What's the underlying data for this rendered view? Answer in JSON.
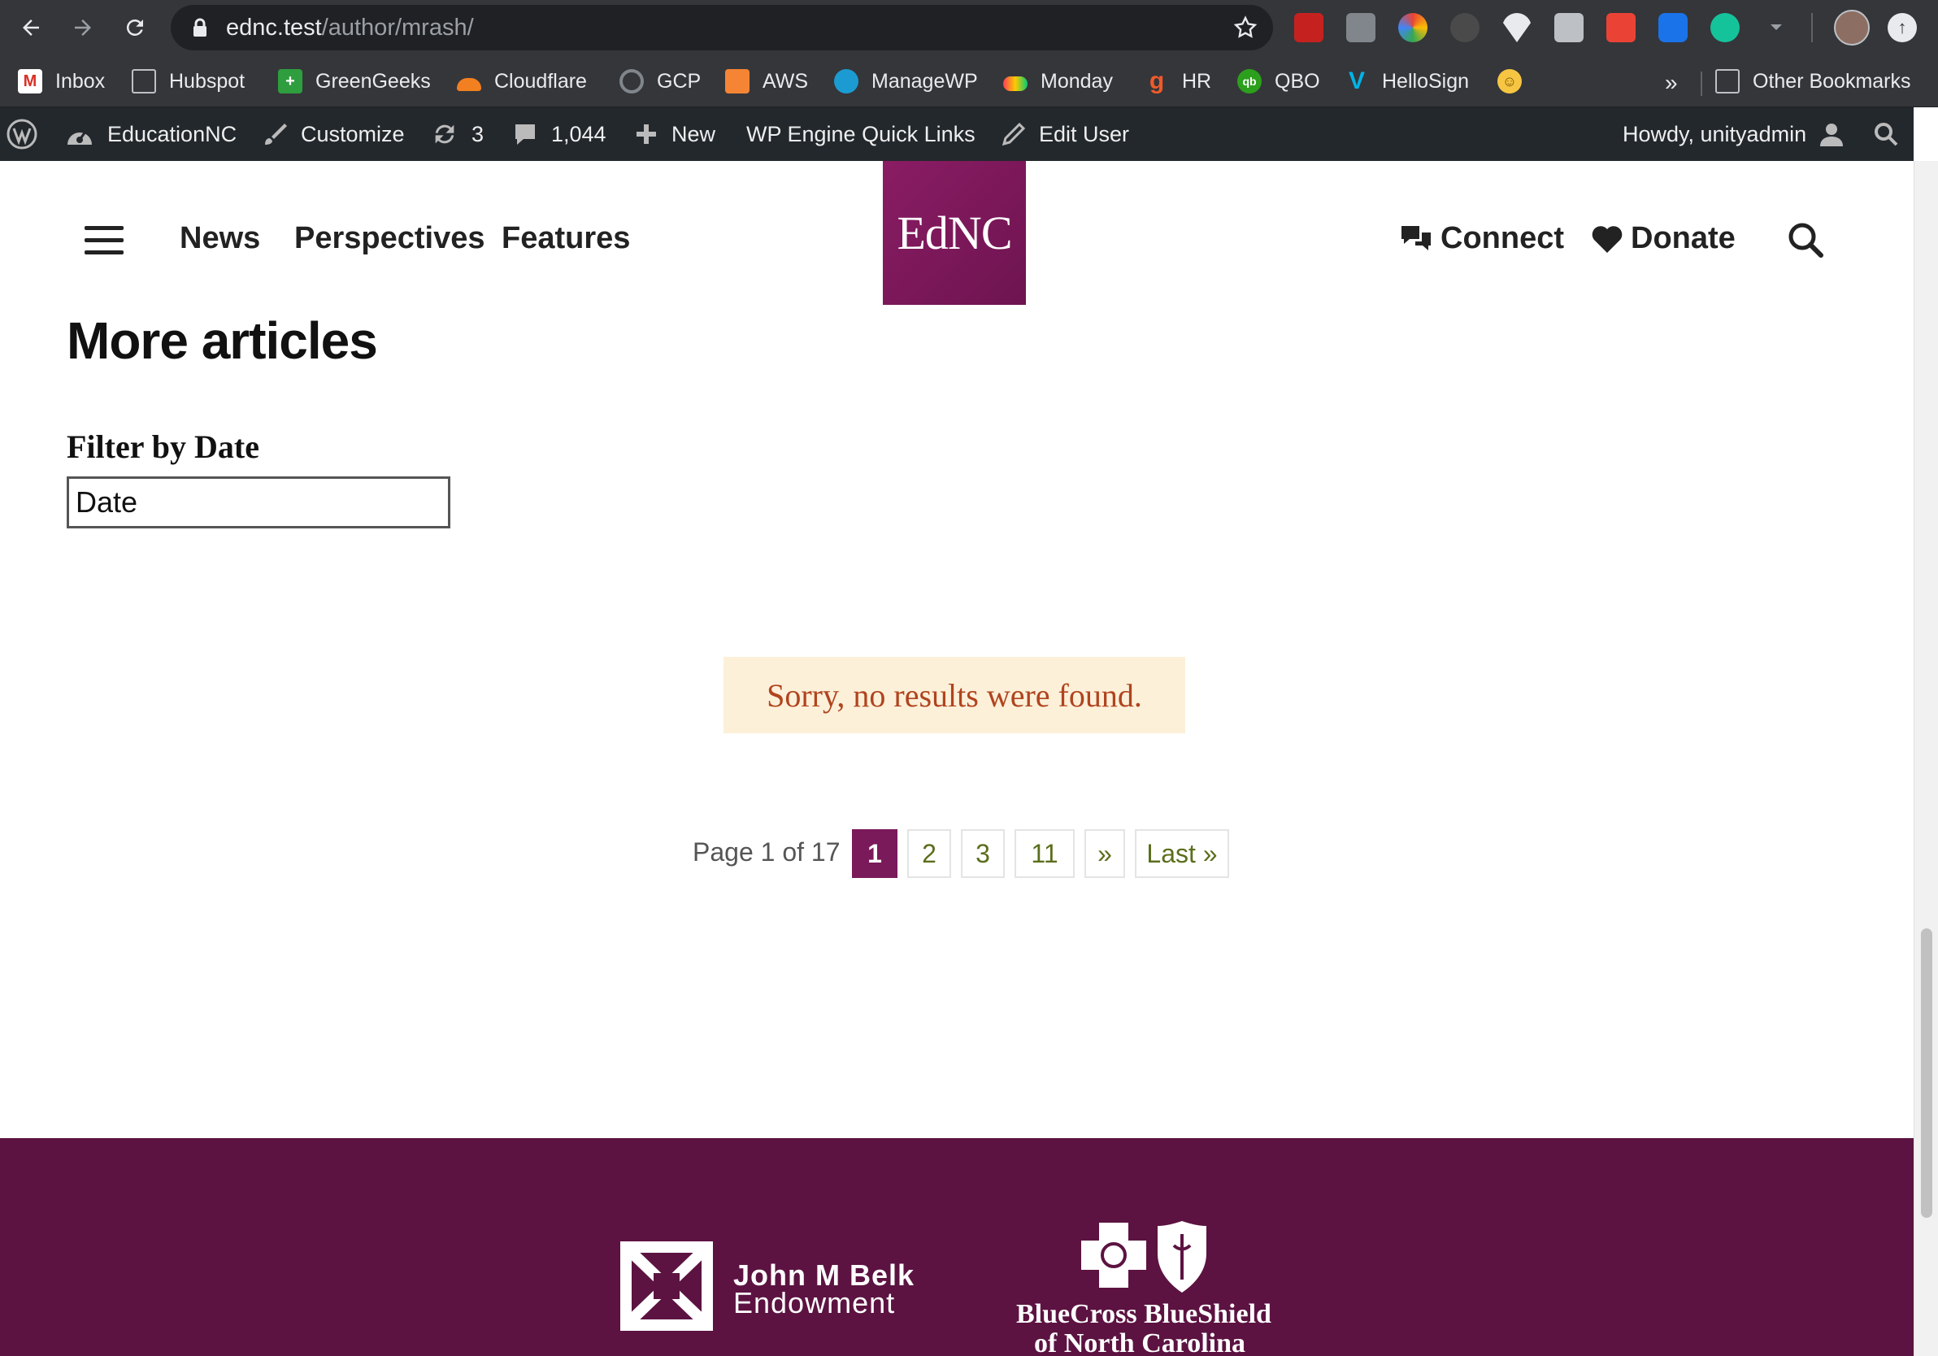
{
  "browser": {
    "url_host": "ednc.test",
    "url_path": "/author/mrash/"
  },
  "bookmarks": [
    {
      "label": "Inbox",
      "icon": "gmail-icon",
      "color": "#d93025"
    },
    {
      "label": "Hubspot",
      "icon": "folder-icon",
      "color": "#9aa0a6"
    },
    {
      "label": "GreenGeeks",
      "icon": "greengeeks-icon",
      "color": "#2e9e3e"
    },
    {
      "label": "Cloudflare",
      "icon": "cloudflare-icon",
      "color": "#f38020"
    },
    {
      "label": "GCP",
      "icon": "gcp-icon",
      "color": "#80868b"
    },
    {
      "label": "AWS",
      "icon": "aws-icon",
      "color": "#f58534"
    },
    {
      "label": "ManageWP",
      "icon": "managewp-icon",
      "color": "#1b9bd1"
    },
    {
      "label": "Monday",
      "icon": "monday-icon",
      "color": "#ff3d57"
    },
    {
      "label": "HR",
      "icon": "hr-icon",
      "color": "#ef5a2a"
    },
    {
      "label": "QBO",
      "icon": "qbo-icon",
      "color": "#2ca01c"
    },
    {
      "label": "HelloSign",
      "icon": "hellosign-icon",
      "color": "#00b3e6"
    },
    {
      "label": "",
      "icon": "smiley-icon",
      "color": "#f6c542"
    }
  ],
  "bookmarks_more": "»",
  "other_bookmarks": "Other Bookmarks",
  "adminbar": {
    "site": "EducationNC",
    "customize": "Customize",
    "updates": "3",
    "comments": "1,044",
    "new": "New",
    "quicklinks": "WP Engine Quick Links",
    "edit_user": "Edit User",
    "howdy": "Howdy, unityadmin"
  },
  "nav": {
    "news": "News",
    "perspectives": "Perspectives",
    "features": "Features",
    "logo": "EdNC",
    "connect": "Connect",
    "donate": "Donate"
  },
  "content": {
    "title": "More articles",
    "filter_label": "Filter by Date",
    "date_placeholder": "Date",
    "no_results": "Sorry, no results were found."
  },
  "pagination": {
    "label": "Page 1 of 17",
    "pages": [
      "1",
      "2",
      "3",
      "11"
    ],
    "next": "»",
    "last": "Last »",
    "current": "1"
  },
  "footer": {
    "belk_name": "John M Belk",
    "belk_sub": "Endowment",
    "bcbs_line1": "BlueCross BlueShield",
    "bcbs_line2": "of North Carolina"
  },
  "colors": {
    "brand": "#7a1a5a",
    "footer": "#5c1341",
    "notice_bg": "#fcf0d9",
    "notice_text": "#b0441e",
    "pager_link": "#5b6e1c"
  }
}
